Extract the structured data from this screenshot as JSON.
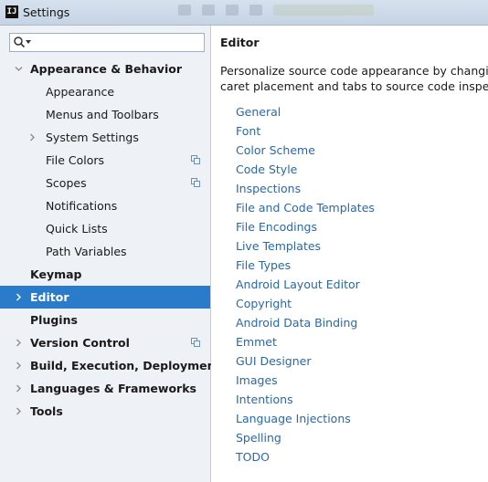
{
  "window": {
    "title": "Settings",
    "app_icon": "IJ"
  },
  "search": {
    "value": "",
    "placeholder": ""
  },
  "sidebar": {
    "items": [
      {
        "label": "Appearance & Behavior",
        "level": 0,
        "bold": true,
        "arrow": "expanded",
        "copy_icon": false,
        "selected": false
      },
      {
        "label": "Appearance",
        "level": 1,
        "bold": false,
        "arrow": "none",
        "copy_icon": false,
        "selected": false
      },
      {
        "label": "Menus and Toolbars",
        "level": 1,
        "bold": false,
        "arrow": "none",
        "copy_icon": false,
        "selected": false
      },
      {
        "label": "System Settings",
        "level": 1,
        "bold": false,
        "arrow": "collapsed",
        "copy_icon": false,
        "selected": false
      },
      {
        "label": "File Colors",
        "level": 1,
        "bold": false,
        "arrow": "none",
        "copy_icon": true,
        "selected": false
      },
      {
        "label": "Scopes",
        "level": 1,
        "bold": false,
        "arrow": "none",
        "copy_icon": true,
        "selected": false
      },
      {
        "label": "Notifications",
        "level": 1,
        "bold": false,
        "arrow": "none",
        "copy_icon": false,
        "selected": false
      },
      {
        "label": "Quick Lists",
        "level": 1,
        "bold": false,
        "arrow": "none",
        "copy_icon": false,
        "selected": false
      },
      {
        "label": "Path Variables",
        "level": 1,
        "bold": false,
        "arrow": "none",
        "copy_icon": false,
        "selected": false
      },
      {
        "label": "Keymap",
        "level": 0,
        "bold": true,
        "arrow": "none",
        "copy_icon": false,
        "selected": false
      },
      {
        "label": "Editor",
        "level": 0,
        "bold": true,
        "arrow": "collapsed",
        "copy_icon": false,
        "selected": true
      },
      {
        "label": "Plugins",
        "level": 0,
        "bold": true,
        "arrow": "none",
        "copy_icon": false,
        "selected": false
      },
      {
        "label": "Version Control",
        "level": 0,
        "bold": true,
        "arrow": "collapsed",
        "copy_icon": true,
        "selected": false
      },
      {
        "label": "Build, Execution, Deployment",
        "level": 0,
        "bold": true,
        "arrow": "collapsed",
        "copy_icon": false,
        "selected": false
      },
      {
        "label": "Languages & Frameworks",
        "level": 0,
        "bold": true,
        "arrow": "collapsed",
        "copy_icon": false,
        "selected": false
      },
      {
        "label": "Tools",
        "level": 0,
        "bold": true,
        "arrow": "collapsed",
        "copy_icon": false,
        "selected": false
      }
    ]
  },
  "content": {
    "heading": "Editor",
    "description_line1": "Personalize source code appearance by changing",
    "description_line2": "caret placement and tabs to source code inspectio",
    "links": [
      "General",
      "Font",
      "Color Scheme",
      "Code Style",
      "Inspections",
      "File and Code Templates",
      "File Encodings",
      "Live Templates",
      "File Types",
      "Android Layout Editor",
      "Copyright",
      "Android Data Binding",
      "Emmet",
      "GUI Designer",
      "Images",
      "Intentions",
      "Language Injections",
      "Spelling",
      "TODO"
    ]
  },
  "colors": {
    "selection": "#2b7bcb",
    "link": "#2968a8",
    "sidebar_bg": "#eef1f5",
    "icon_gray": "#8a8f96",
    "copy_icon": "#6a8fb8"
  }
}
